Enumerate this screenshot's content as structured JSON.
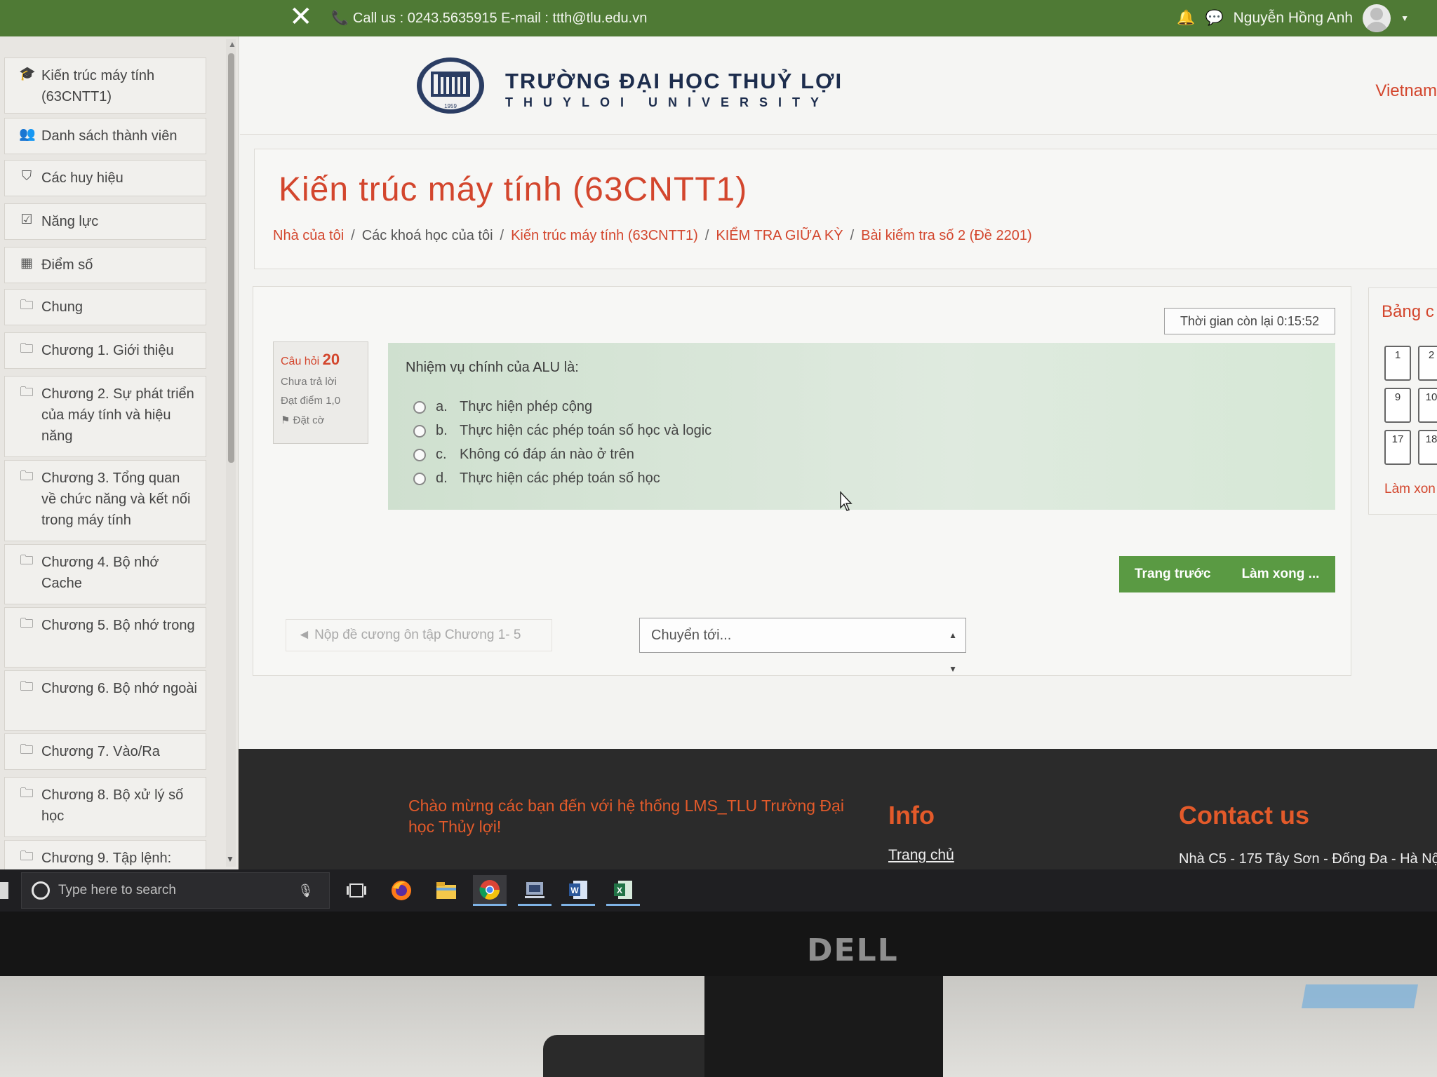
{
  "topbar": {
    "close": "✕",
    "contact": "Call us : 0243.5635915  E-mail : ttth@tlu.edu.vn",
    "user_name": "Nguyễn Hồng Anh"
  },
  "drawer": {
    "items": [
      {
        "icon": "graduation-cap-icon",
        "glyph": "🎓",
        "label": "Kiến trúc máy tính (63CNTT1)"
      },
      {
        "icon": "users-icon",
        "glyph": "👥",
        "label": "Danh sách thành viên"
      },
      {
        "icon": "shield-icon",
        "glyph": "⛉",
        "label": "Các huy hiệu"
      },
      {
        "icon": "checkbox-icon",
        "glyph": "☑",
        "label": "Năng lực"
      },
      {
        "icon": "table-icon",
        "glyph": "▦",
        "label": "Điểm số"
      },
      {
        "icon": "folder-icon",
        "glyph": "🗀",
        "label": "Chung"
      },
      {
        "icon": "folder-icon",
        "glyph": "🗀",
        "label": "Chương 1. Giới thiệu"
      },
      {
        "icon": "folder-icon",
        "glyph": "🗀",
        "label": "Chương 2. Sự phát triển của máy tính và hiệu năng"
      },
      {
        "icon": "folder-icon",
        "glyph": "🗀",
        "label": "Chương 3. Tổng quan về chức năng và kết nối trong máy tính"
      },
      {
        "icon": "folder-icon",
        "glyph": "🗀",
        "label": "Chương 4. Bộ nhớ Cache"
      },
      {
        "icon": "folder-icon",
        "glyph": "🗀",
        "label": "Chương 5. Bộ nhớ trong"
      },
      {
        "icon": "folder-icon",
        "glyph": "🗀",
        "label": "Chương 6. Bộ nhớ ngoài"
      },
      {
        "icon": "folder-icon",
        "glyph": "🗀",
        "label": "Chương 7. Vào/Ra"
      },
      {
        "icon": "folder-icon",
        "glyph": "🗀",
        "label": "Chương 8. Bộ xử lý số học"
      },
      {
        "icon": "folder-icon",
        "glyph": "🗀",
        "label": "Chương 9. Tập lệnh:"
      }
    ]
  },
  "header": {
    "title": "TRƯỜNG ĐẠI HỌC THUỶ LỢI",
    "subtitle": "THUYLOI UNIVERSITY",
    "emblem_year": "1959",
    "language": "Vietnam"
  },
  "page": {
    "heading": "Kiến trúc máy tính (63CNTT1)",
    "breadcrumb": [
      "Nhà của tôi",
      "Các khoá học của tôi",
      "Kiến trúc máy tính (63CNTT1)",
      "KIỂM TRA GIỮA KỲ",
      "Bài kiểm tra số 2 (Đề 2201)"
    ]
  },
  "quiz": {
    "timer": "Thời gian còn lại 0:15:52",
    "question_label": "Câu hỏi",
    "question_number": "20",
    "status": "Chưa trả lời",
    "score": "Đạt điểm 1,0",
    "flag": "Đặt cờ",
    "question_text": "Nhiệm vụ chính của ALU là:",
    "answers": [
      {
        "letter": "a.",
        "text": "Thực hiện phép cộng"
      },
      {
        "letter": "b.",
        "text": "Thực hiện các phép toán số học và logic"
      },
      {
        "letter": "c.",
        "text": "Không có đáp án nào ở trên"
      },
      {
        "letter": "d.",
        "text": "Thực hiện các phép toán số học"
      }
    ],
    "prev_button": "Trang trước",
    "finish_button": "Làm xong ...",
    "prev_activity": "◄ Nộp đề cương ôn tập Chương 1- 5",
    "jump_placeholder": "Chuyển tới...",
    "nav_title": "Bảng c",
    "nav_numbers": [
      "1",
      "2",
      "9",
      "10",
      "17",
      "18"
    ],
    "nav_finish": "Làm xon"
  },
  "footer": {
    "welcome": "Chào mừng các bạn đến với hệ thống LMS_TLU Trường Đại học Thủy lợi!",
    "info_heading": "Info",
    "info_link": "Trang chủ",
    "contact_heading": "Contact us",
    "contact_address": "Nhà C5 - 175 Tây Sơn - Đống Đa - Hà Nộ"
  },
  "taskbar": {
    "search_placeholder": "Type here to search"
  },
  "monitor": {
    "brand": "DELL"
  },
  "colors": {
    "brand_green": "#4f7a35",
    "accent_red": "#d3462d",
    "button_green": "#5a9a43",
    "footer_bg": "#2b2b2b"
  }
}
